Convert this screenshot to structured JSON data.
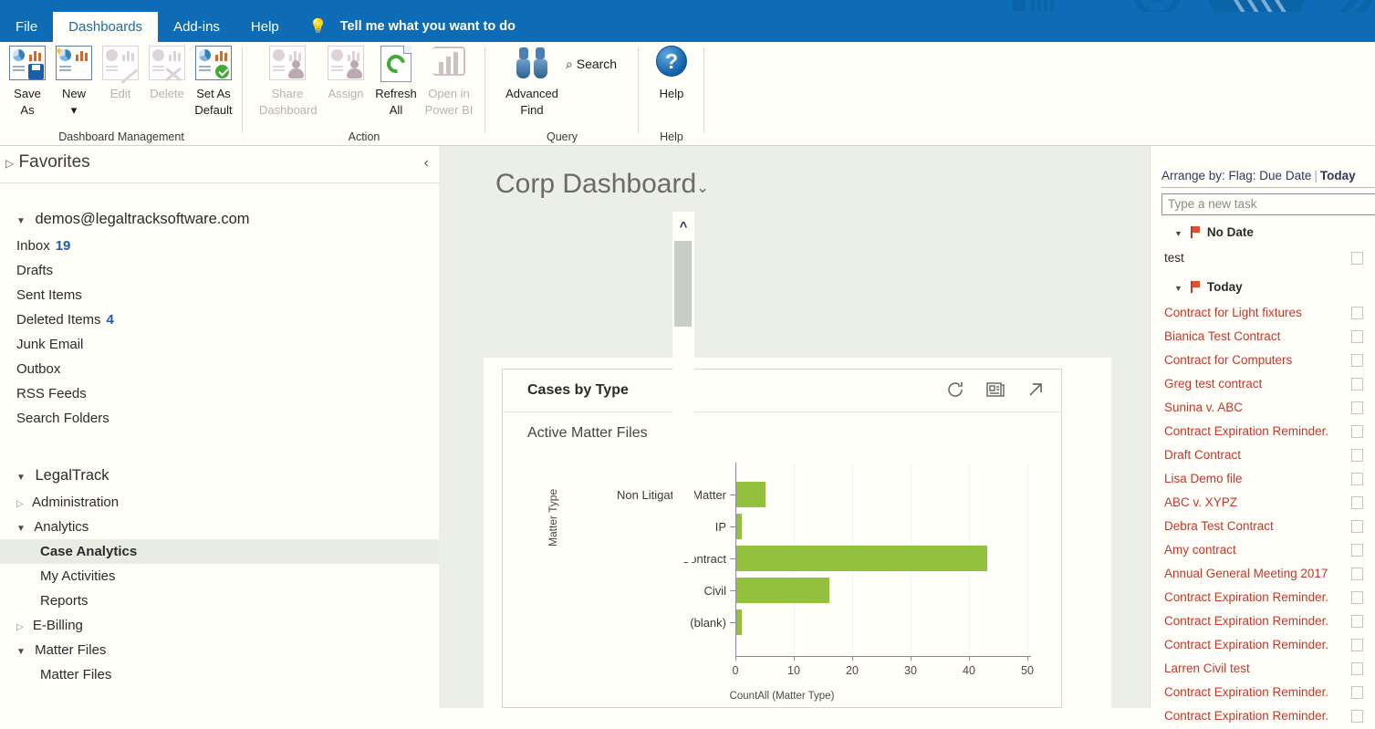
{
  "titlebar": {
    "decorative": "outlook-banner-graphics"
  },
  "ribbon": {
    "tabs": [
      {
        "label": "File",
        "active": false
      },
      {
        "label": "Dashboards",
        "active": true
      },
      {
        "label": "Add-ins",
        "active": false
      },
      {
        "label": "Help",
        "active": false
      }
    ],
    "tellme": "Tell me what you want to do",
    "groups": [
      {
        "name": "Dashboard Management",
        "buttons": [
          {
            "label1": "Save",
            "label2": "As",
            "enabled": true
          },
          {
            "label1": "New",
            "label2": "▾",
            "enabled": true
          },
          {
            "label1": "Edit",
            "label2": "",
            "enabled": false
          },
          {
            "label1": "Delete",
            "label2": "",
            "enabled": false
          },
          {
            "label1": "Set As",
            "label2": "Default",
            "enabled": true
          }
        ]
      },
      {
        "name": "Action",
        "buttons": [
          {
            "label1": "Share",
            "label2": "Dashboard",
            "enabled": false
          },
          {
            "label1": "Assign",
            "label2": "",
            "enabled": false
          },
          {
            "label1": "Refresh",
            "label2": "All",
            "enabled": true
          },
          {
            "label1": "Open in",
            "label2": "Power BI",
            "enabled": false
          }
        ]
      },
      {
        "name": "Query",
        "buttons": [
          {
            "label1": "Advanced",
            "label2": "Find",
            "enabled": true
          }
        ],
        "search_label": "Search"
      },
      {
        "name": "Help",
        "buttons": [
          {
            "label1": "Help",
            "label2": "",
            "enabled": true
          }
        ]
      }
    ]
  },
  "nav": {
    "favorites_label": "Favorites",
    "account": "demos@legaltracksoftware.com",
    "mail_folders": [
      {
        "label": "Inbox",
        "count": "19"
      },
      {
        "label": "Drafts",
        "count": ""
      },
      {
        "label": "Sent Items",
        "count": ""
      },
      {
        "label": "Deleted Items",
        "count": "4"
      },
      {
        "label": "Junk Email",
        "count": ""
      },
      {
        "label": "Outbox",
        "count": ""
      },
      {
        "label": "RSS Feeds",
        "count": ""
      },
      {
        "label": "Search Folders",
        "count": ""
      }
    ],
    "app_root": "LegalTrack",
    "app_items": [
      {
        "label": "Administration",
        "level": 1,
        "expanded": false,
        "selected": false
      },
      {
        "label": "Analytics",
        "level": 1,
        "expanded": true,
        "selected": false
      },
      {
        "label": "Case Analytics",
        "level": 2,
        "expanded": null,
        "selected": true
      },
      {
        "label": "My Activities",
        "level": 2,
        "expanded": null,
        "selected": false
      },
      {
        "label": "Reports",
        "level": 2,
        "expanded": null,
        "selected": false
      },
      {
        "label": "E-Billing",
        "level": 1,
        "expanded": false,
        "selected": false
      },
      {
        "label": "Matter Files",
        "level": 1,
        "expanded": true,
        "selected": false
      },
      {
        "label": "Matter Files",
        "level": 2,
        "expanded": null,
        "selected": false
      }
    ]
  },
  "dashboard": {
    "title": "Corp Dashboard",
    "card": {
      "title": "Cases by Type",
      "icons": [
        "refresh-icon",
        "view-records-icon",
        "expand-icon"
      ]
    }
  },
  "chart_data": {
    "type": "bar",
    "orientation": "horizontal",
    "title": "Active Matter Files",
    "categories": [
      "Non Litigation Matter",
      "IP",
      "Contract",
      "Civil",
      "(blank)"
    ],
    "values": [
      5,
      1,
      43,
      16,
      1
    ],
    "xlabel": "CountAll (Matter Type)",
    "ylabel": "Matter Type",
    "xlim": [
      0,
      50
    ],
    "xticks": [
      0,
      10,
      20,
      30,
      40,
      50
    ],
    "bar_color": "#92c13d",
    "grid": true,
    "legend": false
  },
  "taskpane": {
    "arrange_label": "Arrange by: Flag: Due Date",
    "arrange_value": "Today",
    "new_task_placeholder": "Type a new task",
    "groups": [
      {
        "label": "No Date",
        "tasks": [
          {
            "label": "test",
            "overdue": false
          }
        ]
      },
      {
        "label": "Today",
        "tasks": [
          {
            "label": "Contract for Light fixtures",
            "overdue": true
          },
          {
            "label": "Bianica Test Contract",
            "overdue": true
          },
          {
            "label": "Contract for Computers",
            "overdue": true
          },
          {
            "label": "Greg test contract",
            "overdue": true
          },
          {
            "label": "Sunina v. ABC",
            "overdue": true
          },
          {
            "label": "Contract Expiration Reminder.",
            "overdue": true
          },
          {
            "label": "Draft Contract",
            "overdue": true
          },
          {
            "label": "Lisa Demo file",
            "overdue": true
          },
          {
            "label": "ABC v. XYPZ",
            "overdue": true
          },
          {
            "label": "Debra Test Contract",
            "overdue": true
          },
          {
            "label": "Amy contract",
            "overdue": true
          },
          {
            "label": "Annual General Meeting 2017",
            "overdue": true
          },
          {
            "label": "Contract Expiration Reminder.",
            "overdue": true
          },
          {
            "label": "Contract Expiration Reminder.",
            "overdue": true
          },
          {
            "label": "Contract Expiration Reminder.",
            "overdue": true
          },
          {
            "label": "Larren Civil test",
            "overdue": true
          },
          {
            "label": "Contract Expiration Reminder.",
            "overdue": true
          },
          {
            "label": "Contract Expiration Reminder.",
            "overdue": true
          }
        ]
      }
    ]
  },
  "colors": {
    "ribbon_blue": "#0d6cb5",
    "accent_green": "#92c13d",
    "overdue_red": "#c0392b",
    "canvas": "#ecefe8",
    "surface": "#fffef8"
  }
}
